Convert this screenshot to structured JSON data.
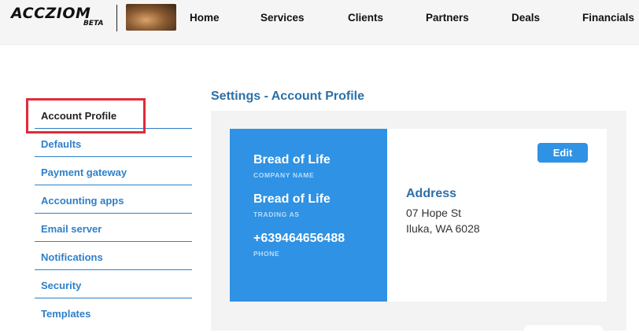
{
  "brand": {
    "name": "ACCZIOM",
    "tag": "BETA"
  },
  "nav": {
    "items": [
      {
        "label": "Home"
      },
      {
        "label": "Services"
      },
      {
        "label": "Clients"
      },
      {
        "label": "Partners"
      },
      {
        "label": "Deals"
      },
      {
        "label": "Financials"
      }
    ]
  },
  "sidebar": {
    "items": [
      {
        "label": "Account Profile"
      },
      {
        "label": "Defaults"
      },
      {
        "label": "Payment gateway"
      },
      {
        "label": "Accounting apps"
      },
      {
        "label": "Email server"
      },
      {
        "label": "Notifications"
      },
      {
        "label": "Security"
      },
      {
        "label": "Templates"
      }
    ]
  },
  "main": {
    "title": "Settings - Account Profile",
    "company_name": "Bread of Life",
    "company_name_label": "COMPANY NAME",
    "trading_as": "Bread of Life",
    "trading_as_label": "TRADING AS",
    "phone": "+639464656488",
    "phone_label": "PHONE",
    "address_heading": "Address",
    "address_line1": "07 Hope St",
    "address_line2": "Iluka, WA 6028",
    "edit_label": "Edit"
  },
  "colors": {
    "accent": "#2f92e4",
    "link": "#2f80c8",
    "highlight": "#e02b3a"
  }
}
